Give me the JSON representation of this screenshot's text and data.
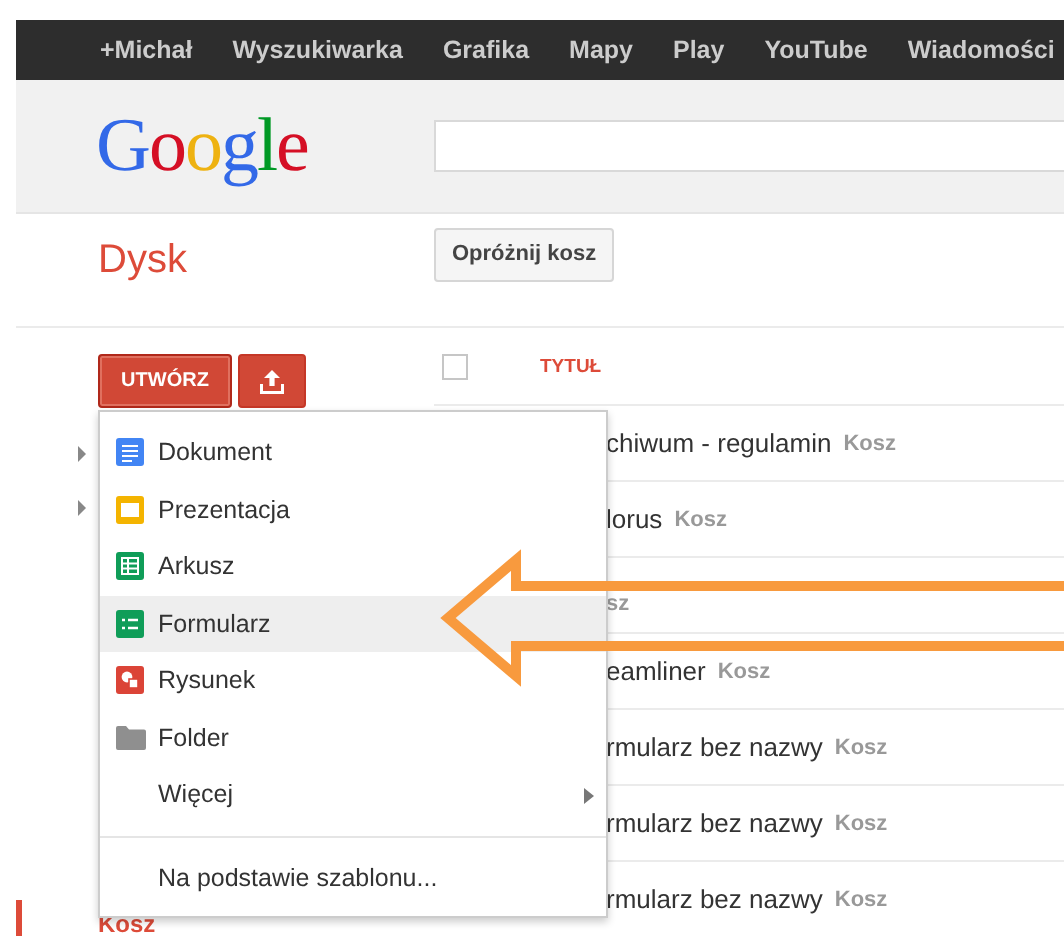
{
  "top_nav": [
    {
      "label": "+Michał"
    },
    {
      "label": "Wyszukiwarka"
    },
    {
      "label": "Grafika"
    },
    {
      "label": "Mapy"
    },
    {
      "label": "Play"
    },
    {
      "label": "YouTube"
    },
    {
      "label": "Wiadomości"
    }
  ],
  "header": {
    "logo": "Google"
  },
  "page_title": "Dysk",
  "empty_trash_button": "Opróżnij kosz",
  "create_button": "UTWÓRZ",
  "sidebar": {
    "tree_items": [
      {
        "expanded": false
      },
      {
        "expanded": false
      }
    ],
    "trash_label": "Kosz"
  },
  "table": {
    "select_all": {
      "checked": false
    },
    "columns": [
      {
        "label": "TYTUŁ"
      }
    ],
    "rows": [
      {
        "title": "chiwum - regulamin",
        "tag": "Kosz"
      },
      {
        "title": "lorus",
        "tag": "Kosz"
      },
      {
        "tag_fragment": "sz"
      },
      {
        "title": "eamliner",
        "tag": "Kosz"
      },
      {
        "title": "rmularz bez nazwy",
        "tag": "Kosz"
      },
      {
        "title": "rmularz bez nazwy",
        "tag": "Kosz"
      },
      {
        "title": "rmularz bez nazwy",
        "tag": "Kosz"
      }
    ]
  },
  "create_menu": {
    "items": [
      {
        "kind": "document",
        "label": "Dokument",
        "selected": false
      },
      {
        "kind": "presentation",
        "label": "Prezentacja",
        "selected": false
      },
      {
        "kind": "spreadsheet",
        "label": "Arkusz",
        "selected": false
      },
      {
        "kind": "form",
        "label": "Formularz",
        "selected": true
      },
      {
        "kind": "drawing",
        "label": "Rysunek",
        "selected": false
      },
      {
        "kind": "folder",
        "label": "Folder",
        "selected": false
      },
      {
        "kind": "submenu",
        "label": "Więcej",
        "selected": false
      },
      {
        "kind": "template",
        "label": "Na podstawie szablonu...",
        "selected": false
      }
    ]
  }
}
